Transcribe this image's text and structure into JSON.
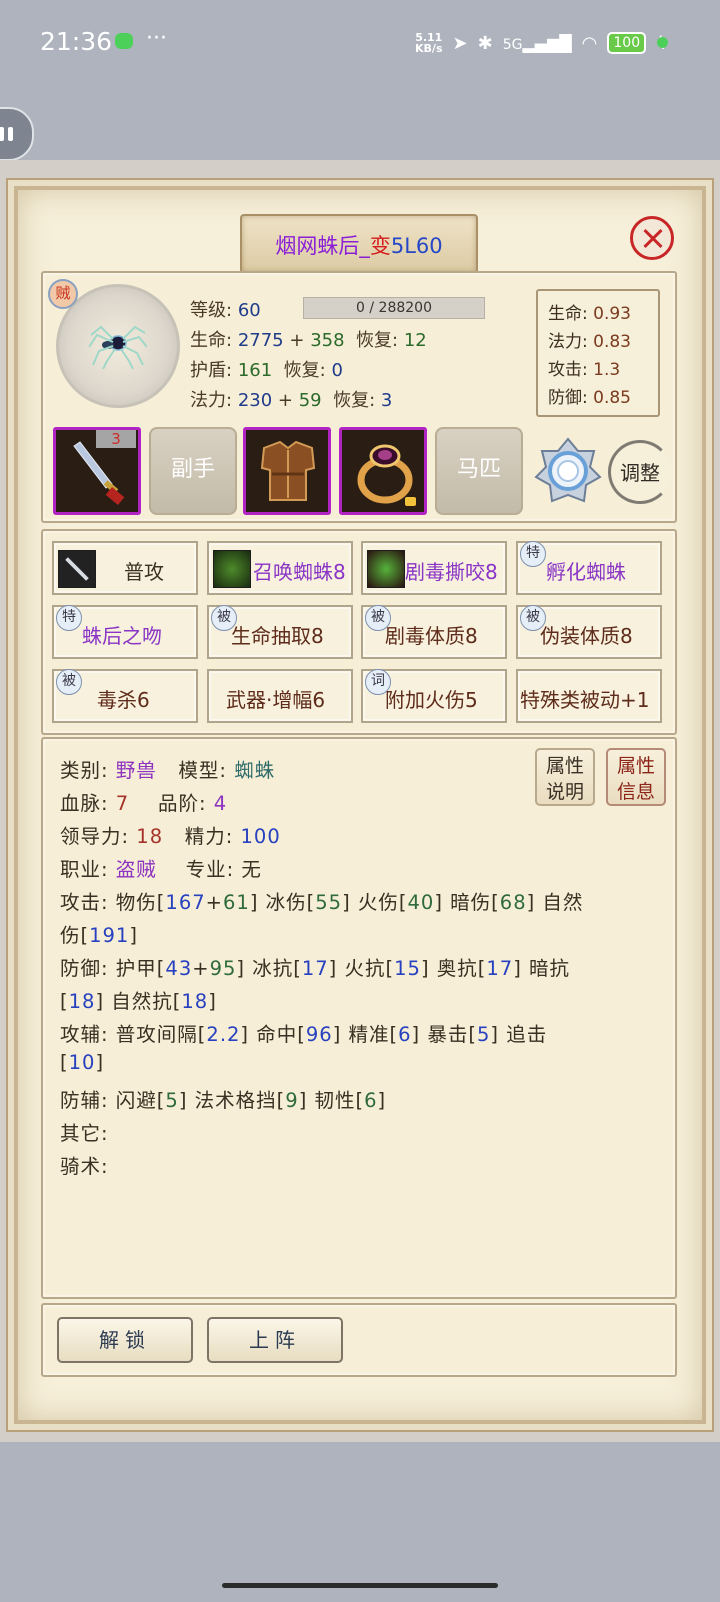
{
  "status_bar": {
    "time": "21:36",
    "dots": "···",
    "net_speed_top": "5.11",
    "net_speed_bottom": "KB/s",
    "signal": "5G",
    "battery": "100"
  },
  "title": {
    "name_main": "烟网蛛后_",
    "name_variant": "变",
    "name_suffix": "5L60"
  },
  "portrait": {
    "class_badge": "贼"
  },
  "stats": {
    "level_label": "等级:",
    "level_value": "60",
    "exp": "0 / 288200",
    "hp_label": "生命:",
    "hp_base": "2775",
    "hp_plus": "+",
    "hp_bonus": "358",
    "hp_regen_label": "恢复:",
    "hp_regen": "12",
    "shield_label": "护盾:",
    "shield_value": "161",
    "shield_regen_label": "恢复:",
    "shield_regen": "0",
    "mp_label": "法力:",
    "mp_base": "230",
    "mp_plus": "+",
    "mp_bonus": "59",
    "mp_regen_label": "恢复:",
    "mp_regen": "3"
  },
  "growth": [
    {
      "label": "生命:",
      "value": "0.93"
    },
    {
      "label": "法力:",
      "value": "0.83"
    },
    {
      "label": "攻击:",
      "value": "1.3"
    },
    {
      "label": "防御:",
      "value": "0.85"
    }
  ],
  "equipment": {
    "weapon_qty": "3",
    "offhand_label": "副手",
    "mount_label": "马匹",
    "adjust_label": "调整"
  },
  "skills": [
    {
      "label": "普攻",
      "tag": "",
      "color": "#3d3123"
    },
    {
      "label": "召唤蜘蛛8",
      "tag": "",
      "color": "#8a34c5"
    },
    {
      "label": "剧毒撕咬8",
      "tag": "",
      "color": "#8a34c5"
    },
    {
      "label": "孵化蜘蛛",
      "tag": "特",
      "color": "#8a34c5"
    },
    {
      "label": "蛛后之吻",
      "tag": "特",
      "color": "#8a34c5"
    },
    {
      "label": "生命抽取8",
      "tag": "被",
      "color": "#5f2b1a"
    },
    {
      "label": "剧毒体质8",
      "tag": "被",
      "color": "#5f2b1a"
    },
    {
      "label": "伪装体质8",
      "tag": "被",
      "color": "#5f2b1a"
    },
    {
      "label": "毒杀6",
      "tag": "被",
      "color": "#5f2b1a"
    },
    {
      "label": "武器·增幅6",
      "tag": "",
      "color": "#5f2b1a"
    },
    {
      "label": "附加火伤5",
      "tag": "词",
      "color": "#5f2b1a"
    },
    {
      "label": "特殊类被动+1",
      "tag": "",
      "color": "#5f2b1a"
    }
  ],
  "info": {
    "category_label": "类别:",
    "category": "野兽",
    "model_label": "模型:",
    "model": "蜘蛛",
    "bloodline_label": "血脉:",
    "bloodline": "7",
    "grade_label": "品阶:",
    "grade": "4",
    "leadership_label": "领导力:",
    "leadership": "18",
    "energy_label": "精力:",
    "energy": "100",
    "job_label": "职业:",
    "job": "盗贼",
    "spec_label": "专业:",
    "spec": "无",
    "attack_label": "攻击:",
    "attack": [
      {
        "name": "物伤",
        "base": "167",
        "bonus": "61"
      },
      {
        "name": "冰伤",
        "base": "55"
      },
      {
        "name": "火伤",
        "base": "40"
      },
      {
        "name": "暗伤",
        "base": "68"
      },
      {
        "name": "自然伤",
        "base": "191"
      }
    ],
    "defense_label": "防御:",
    "defense": [
      {
        "name": "护甲",
        "base": "43",
        "bonus": "95"
      },
      {
        "name": "冰抗",
        "base": "17"
      },
      {
        "name": "火抗",
        "base": "15"
      },
      {
        "name": "奥抗",
        "base": "17"
      },
      {
        "name": "暗抗",
        "base": "18"
      },
      {
        "name": "自然抗",
        "base": "18"
      }
    ],
    "atk_aux_label": "攻辅:",
    "atk_aux": [
      {
        "name": "普攻间隔",
        "base": "2.2"
      },
      {
        "name": "命中",
        "base": "96"
      },
      {
        "name": "精准",
        "base": "6"
      },
      {
        "name": "暴击",
        "base": "5"
      },
      {
        "name": "追击",
        "base": "10"
      }
    ],
    "def_aux_label": "防辅:",
    "def_aux": [
      {
        "name": "闪避",
        "base": "5"
      },
      {
        "name": "法术格挡",
        "base": "9"
      },
      {
        "name": "韧性",
        "base": "6"
      }
    ],
    "other_label": "其它:",
    "riding_label": "骑术:"
  },
  "attr_buttons": {
    "explain_line1": "属性",
    "explain_line2": "说明",
    "info_line1": "属性",
    "info_line2": "信息"
  },
  "buttons": {
    "unlock": "解锁",
    "deploy": "上阵"
  }
}
